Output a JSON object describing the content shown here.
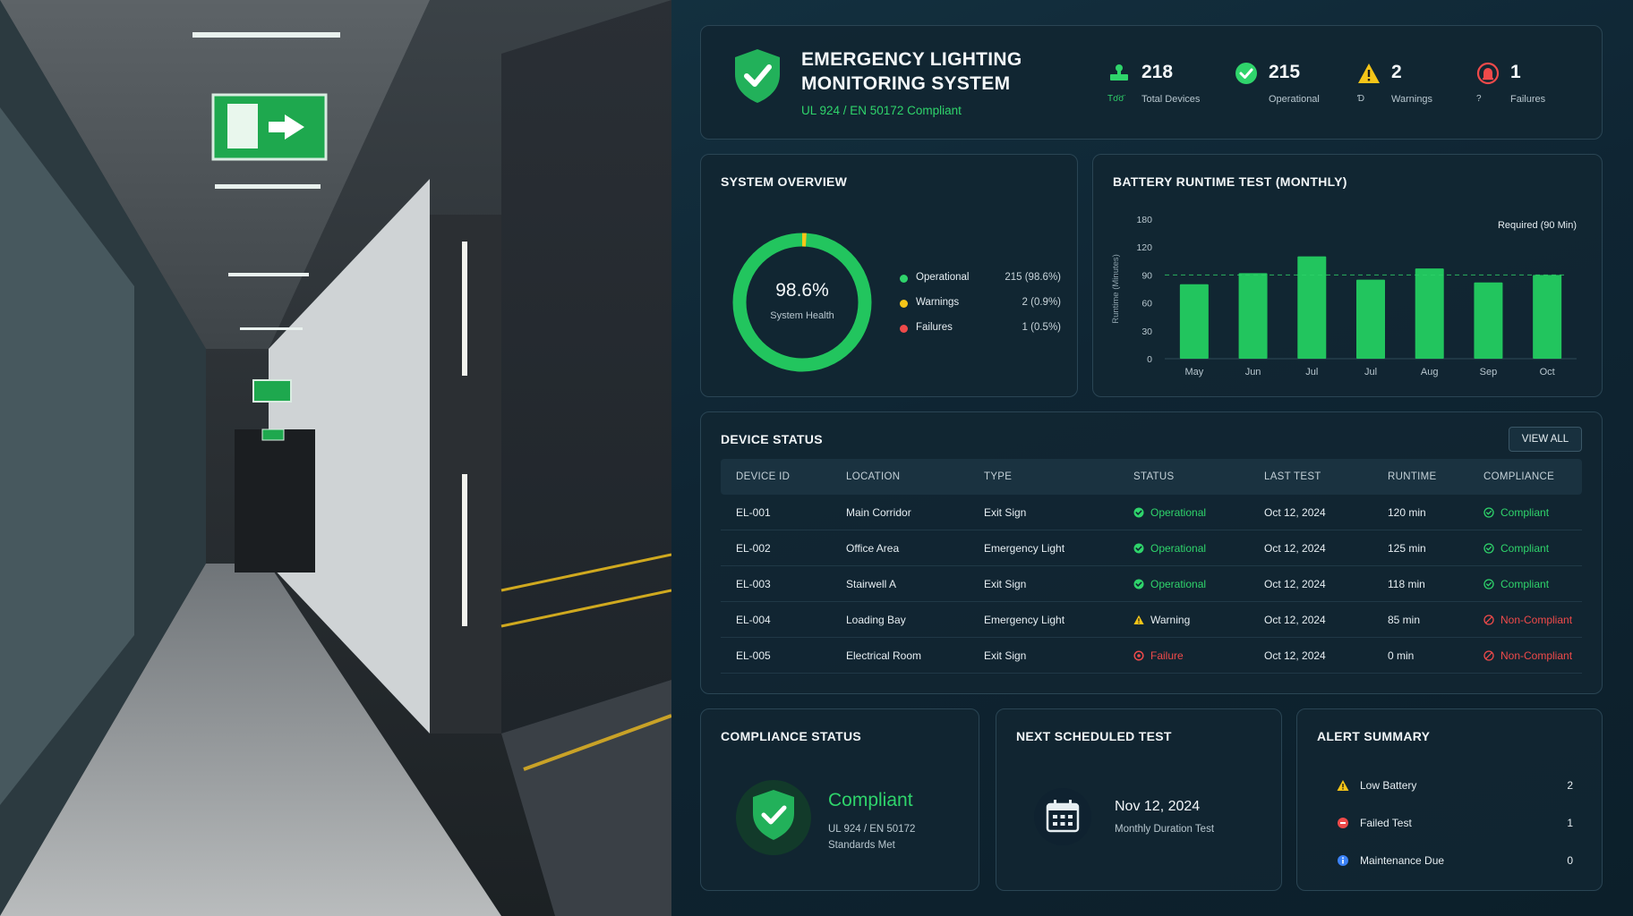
{
  "header": {
    "title_line1": "EMERGENCY LIGHTING",
    "title_line2": "MONITORING SYSTEM",
    "subtitle": "UL 924 / EN 50172 Compliant",
    "stats": [
      {
        "value": "218",
        "label": "Total Devices",
        "mini": "Tσ̈σ̈",
        "icon": "devices-icon",
        "color": "#2fd46b"
      },
      {
        "value": "215",
        "label": "Operational",
        "mini": "",
        "icon": "check-circle-icon",
        "color": "#2fd46b"
      },
      {
        "value": "2",
        "label": "Warnings",
        "mini": "Ɗ",
        "icon": "warning-icon",
        "color": "#f5c518"
      },
      {
        "value": "1",
        "label": "Failures",
        "mini": "?",
        "icon": "alarm-icon",
        "color": "#ef4a4a"
      }
    ]
  },
  "overview": {
    "title": "SYSTEM OVERVIEW",
    "health_value": "98.6%",
    "health_label": "System Health",
    "legend": [
      {
        "name": "Operational",
        "value": "215 (98.6%)",
        "color": "#2fd46b"
      },
      {
        "name": "Warnings",
        "value": "2 (0.9%)",
        "color": "#f5c518"
      },
      {
        "name": "Failures",
        "value": "1 (0.5%)",
        "color": "#ef4a4a"
      }
    ]
  },
  "chart_data": {
    "type": "bar",
    "title": "BATTERY RUNTIME TEST (MONTHLY)",
    "ylabel": "Runtime (Minutes)",
    "categories": [
      "May",
      "Jun",
      "Jul",
      "Jul",
      "Aug",
      "Sep",
      "Oct"
    ],
    "values": [
      80,
      92,
      110,
      85,
      97,
      82,
      90
    ],
    "yticks": [
      "0",
      "30",
      "60",
      "90",
      "120",
      "180"
    ],
    "ytick_values": [
      0,
      30,
      60,
      90,
      120,
      180
    ],
    "ylim": [
      0,
      180
    ],
    "reference_line": {
      "label": "Required (90 Min)",
      "value": 90
    },
    "bar_color": "#22c55e"
  },
  "devices": {
    "title": "DEVICE STATUS",
    "view_all": "VIEW ALL",
    "columns": [
      "DEVICE ID",
      "LOCATION",
      "TYPE",
      "STATUS",
      "LAST TEST",
      "RUNTIME",
      "COMPLIANCE"
    ],
    "rows": [
      {
        "id": "EL-001",
        "location": "Main Corridor",
        "type": "Exit Sign",
        "status": "Operational",
        "status_kind": "ok",
        "last_test": "Oct 12, 2024",
        "runtime": "120 min",
        "compliance": "Compliant",
        "compliance_kind": "ok"
      },
      {
        "id": "EL-002",
        "location": "Office Area",
        "type": "Emergency Light",
        "status": "Operational",
        "status_kind": "ok",
        "last_test": "Oct 12, 2024",
        "runtime": "125 min",
        "compliance": "Compliant",
        "compliance_kind": "ok"
      },
      {
        "id": "EL-003",
        "location": "Stairwell A",
        "type": "Exit Sign",
        "status": "Operational",
        "status_kind": "ok",
        "last_test": "Oct 12, 2024",
        "runtime": "118 min",
        "compliance": "Compliant",
        "compliance_kind": "ok"
      },
      {
        "id": "EL-004",
        "location": "Loading Bay",
        "type": "Emergency Light",
        "status": "Warning",
        "status_kind": "warn",
        "last_test": "Oct 12, 2024",
        "runtime": "85 min",
        "compliance": "Non-Compliant",
        "compliance_kind": "bad"
      },
      {
        "id": "EL-005",
        "location": "Electrical Room",
        "type": "Exit Sign",
        "status": "Failure",
        "status_kind": "bad",
        "last_test": "Oct 12, 2024",
        "runtime": "0 min",
        "compliance": "Non-Compliant",
        "compliance_kind": "bad"
      }
    ]
  },
  "compliance": {
    "title": "COMPLIANCE STATUS",
    "status": "Compliant",
    "line1": "UL 924 / EN 50172",
    "line2": "Standards Met"
  },
  "next_test": {
    "title": "NEXT SCHEDULED TEST",
    "date": "Nov 12, 2024",
    "description": "Monthly Duration Test"
  },
  "alerts": {
    "title": "ALERT SUMMARY",
    "items": [
      {
        "name": "Low Battery",
        "count": "2",
        "icon": "warning-icon",
        "color": "#f5c518"
      },
      {
        "name": "Failed Test",
        "count": "1",
        "icon": "error-dot-icon",
        "color": "#ef4a4a"
      },
      {
        "name": "Maintenance Due",
        "count": "0",
        "icon": "info-icon",
        "color": "#3b82f6"
      }
    ]
  },
  "colors": {
    "accent": "#2fd46b",
    "warning": "#f5c518",
    "danger": "#ef4a4a",
    "info": "#3b82f6"
  }
}
